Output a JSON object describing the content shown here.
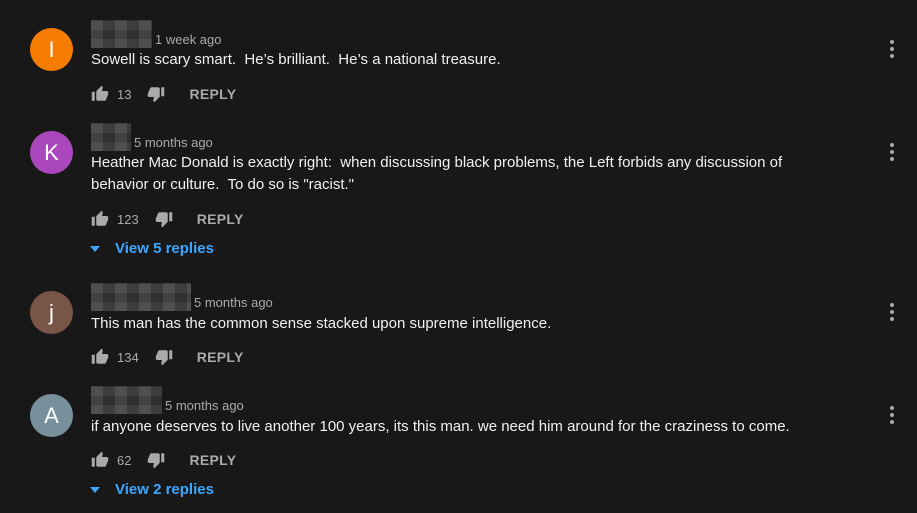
{
  "comments": [
    {
      "avatar_letter": "I",
      "avatar_color": "#f57c00",
      "timestamp": "1 week ago",
      "text": "Sowell is scary smart.  He’s brilliant.  He’s a national treasure.",
      "likes": "13",
      "reply_label": "REPLY"
    },
    {
      "avatar_letter": "K",
      "avatar_color": "#ab47bc",
      "timestamp": "5 months ago",
      "text": "Heather Mac Donald is exactly right:  when discussing black problems, the Left forbids any discussion of\nbehavior or culture.  To do so is \"racist.\"",
      "likes": "123",
      "reply_label": "REPLY",
      "view_replies": "View 5 replies"
    },
    {
      "avatar_letter": "j",
      "avatar_color": "#795548",
      "timestamp": "5 months ago",
      "text": "This man has the common sense stacked upon supreme intelligence.",
      "likes": "134",
      "reply_label": "REPLY"
    },
    {
      "avatar_letter": "A",
      "avatar_color": "#78909c",
      "timestamp": "5 months ago",
      "text": "if anyone deserves to live another 100 years, its this man. we need him around for the craziness to come.",
      "likes": "62",
      "reply_label": "REPLY",
      "view_replies": "View 2 replies"
    }
  ],
  "icons": {
    "like": "thumbs-up-icon",
    "dislike": "thumbs-down-icon",
    "menu": "vertical-ellipsis-icon",
    "expand": "caret-down-icon"
  },
  "colors": {
    "background": "#181818",
    "text": "#f1f1f1",
    "secondary_text": "#aaaaaa",
    "link": "#3ea6ff"
  }
}
